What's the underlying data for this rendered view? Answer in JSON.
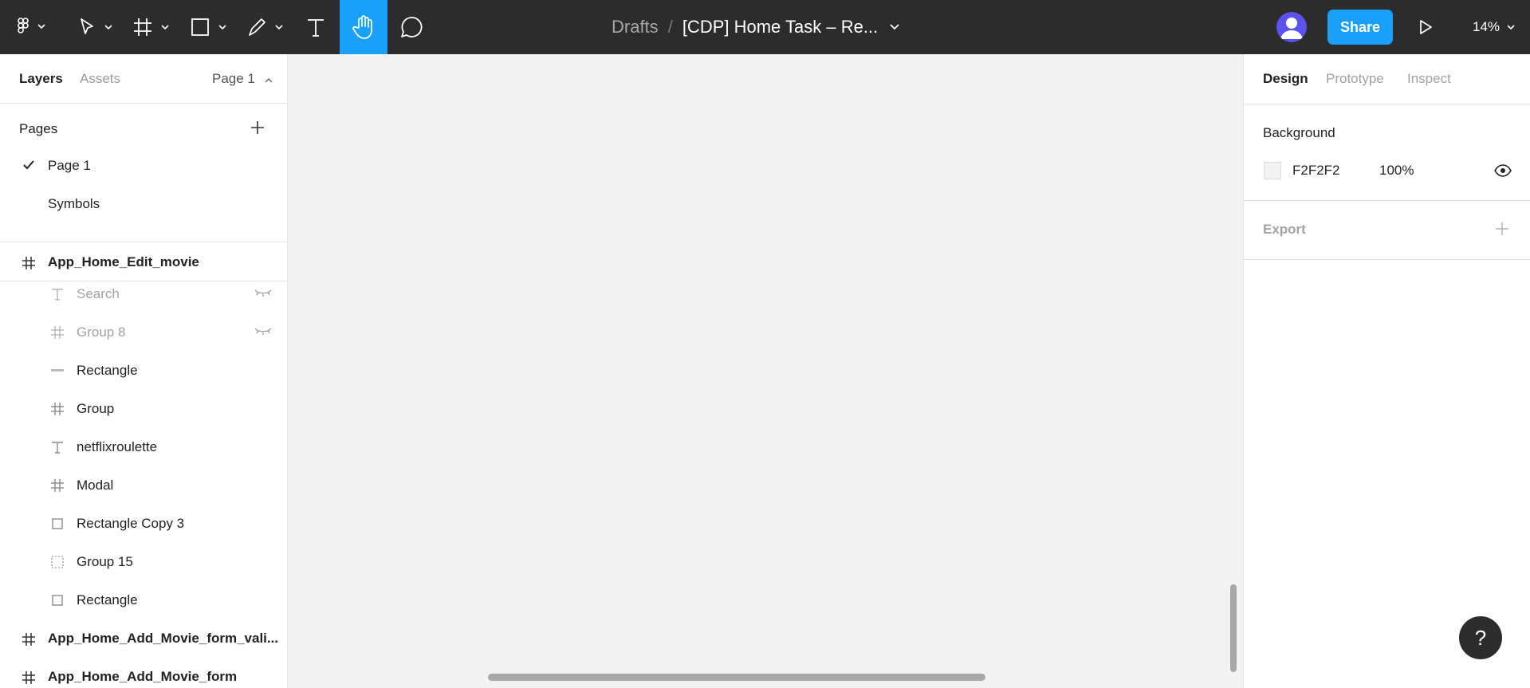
{
  "toolbar": {
    "icons": [
      "figma-menu-icon",
      "move-tool-icon",
      "frame-tool-icon",
      "shape-tool-icon",
      "pen-tool-icon",
      "text-tool-icon",
      "hand-tool-icon",
      "comment-tool-icon"
    ],
    "active_tool": "hand-tool-icon",
    "breadcrumb_root": "Drafts",
    "breadcrumb_sep": "/",
    "file_title": "[CDP] Home Task – Re...",
    "share_label": "Share",
    "zoom_level": "14%",
    "accent": "#18a0fb"
  },
  "left_panel": {
    "tab_layers": "Layers",
    "tab_assets": "Assets",
    "page_selector": "Page 1",
    "pages_heading": "Pages",
    "pages": [
      {
        "label": "Page 1",
        "selected": true
      },
      {
        "label": "Symbols",
        "selected": false
      }
    ],
    "frames": [
      {
        "name": "App_Home_Edit_movie"
      },
      {
        "name": "App_Home_Add_Movie_form_vali..."
      },
      {
        "name": "App_Home_Add_Movie_form"
      }
    ],
    "layers": [
      {
        "name": "Search",
        "icon": "text-icon",
        "hidden": true
      },
      {
        "name": "Group 8",
        "icon": "frame-icon",
        "hidden": true
      },
      {
        "name": "Rectangle",
        "icon": "line-icon",
        "hidden": false
      },
      {
        "name": "Group",
        "icon": "frame-icon",
        "hidden": false
      },
      {
        "name": "netflixroulette",
        "icon": "text-icon",
        "hidden": false
      },
      {
        "name": "Modal",
        "icon": "frame-icon",
        "hidden": false
      },
      {
        "name": "Rectangle Copy 3",
        "icon": "rectangle-icon",
        "hidden": false
      },
      {
        "name": "Group 15",
        "icon": "group-icon",
        "hidden": false
      },
      {
        "name": "Rectangle",
        "icon": "rectangle-icon",
        "hidden": false
      }
    ]
  },
  "right_panel": {
    "tab_design": "Design",
    "tab_prototype": "Prototype",
    "tab_inspect": "Inspect",
    "background_heading": "Background",
    "background_hex": "F2F2F2",
    "background_opacity": "100%",
    "export_heading": "Export"
  },
  "help_label": "?"
}
